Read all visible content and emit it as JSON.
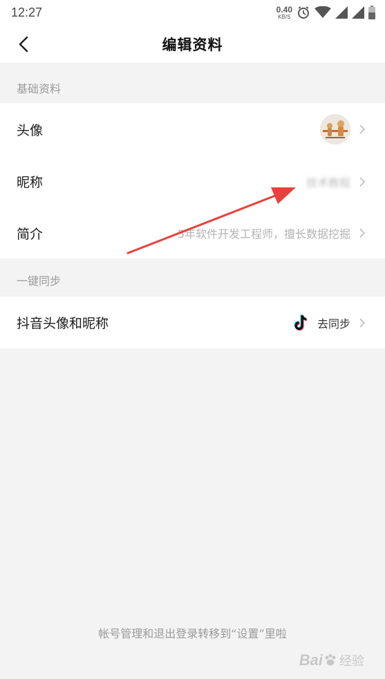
{
  "status_bar": {
    "time": "12:27",
    "net_speed_value": "0.40",
    "net_speed_unit": "KB/S",
    "icons": [
      "alarm-icon",
      "wifi-icon",
      "signal-icon",
      "signal-icon",
      "battery-icon"
    ]
  },
  "header": {
    "title": "编辑资料",
    "back_icon": "chevron-left-icon"
  },
  "sections": {
    "basic": {
      "title": "基础资料",
      "avatar_label": "头像",
      "nickname_label": "昵称",
      "nickname_value": "技术教程",
      "bio_label": "简介",
      "bio_value": "5年软件开发工程师，擅长数据挖掘"
    },
    "sync": {
      "title": "一键同步",
      "douyin_label": "抖音头像和昵称",
      "douyin_action": "去同步",
      "douyin_icon": "tiktok-icon"
    }
  },
  "footer": {
    "note": "帐号管理和退出登录转移到“设置”里啦"
  },
  "watermark": {
    "brand": "Bai",
    "suffix": "经验"
  },
  "colors": {
    "background": "#f3f3f3",
    "annotation_arrow": "#e8413b",
    "secondary_text": "#9a9a9a"
  }
}
